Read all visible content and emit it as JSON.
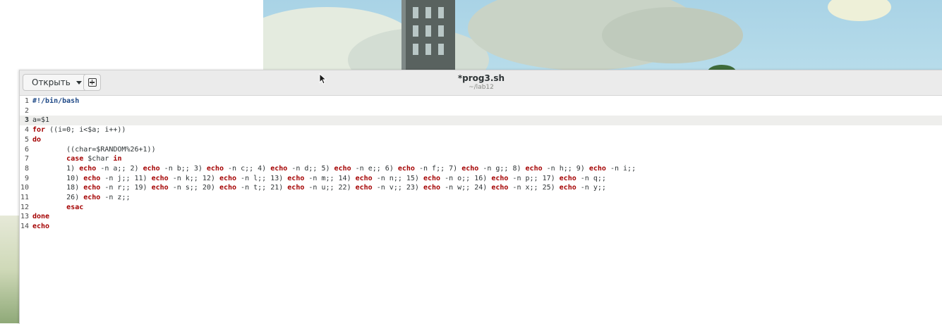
{
  "window": {
    "title": "*prog3.sh",
    "subtitle": "~/lab12",
    "open_label": "Открыть"
  },
  "colors": {
    "keyword": "#a40000",
    "shebang": "#204a87",
    "current_line_bg": "#eeeeec",
    "headerbar_bg": "#ebebeb"
  },
  "icons": {
    "open_dropdown": "chevron-down-icon",
    "new_document": "new-tab-icon",
    "mouse_pointer": "arrow-cursor-icon"
  },
  "editor": {
    "current_line": 3,
    "lines": [
      {
        "n": "1",
        "c": "#!/bin/bash"
      },
      {
        "n": "2",
        "c": ""
      },
      {
        "n": "3",
        "c": "a=$1"
      },
      {
        "n": "4",
        "c": "for ((i=0; i<$a; i++))"
      },
      {
        "n": "5",
        "c": "do"
      },
      {
        "n": "6",
        "c": "        ((char=$RANDOM%26+1))"
      },
      {
        "n": "7",
        "c": "        case $char in"
      },
      {
        "n": "8",
        "c": "        1) echo -n a;; 2) echo -n b;; 3) echo -n c;; 4) echo -n d;; 5) echo -n e;; 6) echo -n f;; 7) echo -n g;; 8) echo -n h;; 9) echo -n i;;"
      },
      {
        "n": "9",
        "c": "        10) echo -n j;; 11) echo -n k;; 12) echo -n l;; 13) echo -n m;; 14) echo -n n;; 15) echo -n o;; 16) echo -n p;; 17) echo -n q;;"
      },
      {
        "n": "10",
        "c": "        18) echo -n r;; 19) echo -n s;; 20) echo -n t;; 21) echo -n u;; 22) echo -n v;; 23) echo -n w;; 24) echo -n x;; 25) echo -n y;;"
      },
      {
        "n": "11",
        "c": "        26) echo -n z;;"
      },
      {
        "n": "12",
        "c": "        esac"
      },
      {
        "n": "13",
        "c": "done"
      },
      {
        "n": "14",
        "c": "echo"
      }
    ]
  }
}
